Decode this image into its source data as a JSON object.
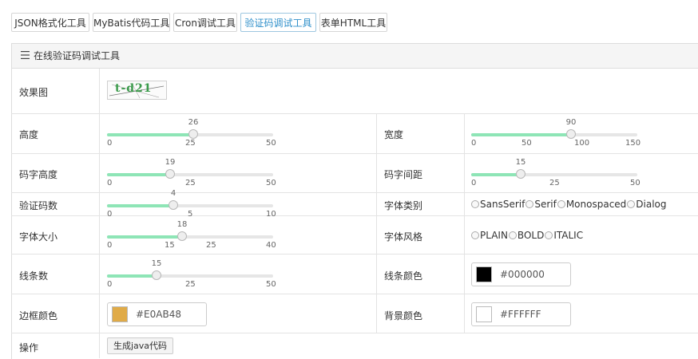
{
  "tabs": [
    {
      "label": "JSON格式化工具",
      "active": false
    },
    {
      "label": "MyBatis代码工具",
      "active": false
    },
    {
      "label": "Cron调试工具",
      "active": false
    },
    {
      "label": "验证码调试工具",
      "active": true
    },
    {
      "label": "表单HTML工具",
      "active": false
    }
  ],
  "panel": {
    "title": "在线验证码调试工具"
  },
  "rows": {
    "preview": {
      "label": "效果图",
      "captcha_text": "t-d21"
    },
    "height": {
      "label": "高度",
      "value": 26,
      "min": 0,
      "max": 50,
      "ticks": [
        "0",
        "25",
        "50"
      ]
    },
    "width": {
      "label": "宽度",
      "value": 90,
      "min": 0,
      "max": 150,
      "ticks": [
        "0",
        "50",
        "100",
        "150"
      ]
    },
    "font_height": {
      "label": "码字高度",
      "value": 19,
      "min": 0,
      "max": 50,
      "ticks": [
        "0",
        "25",
        "50"
      ]
    },
    "char_spacing": {
      "label": "码字间距",
      "value": 15,
      "min": 0,
      "max": 50,
      "ticks": [
        "0",
        "25",
        "50"
      ]
    },
    "char_count": {
      "label": "验证码数",
      "value": 4,
      "min": 0,
      "max": 10,
      "ticks": [
        "0",
        "5",
        "10"
      ]
    },
    "font_family": {
      "label": "字体类别",
      "options": [
        "SansSerif",
        "Serif",
        "Monospaced",
        "Dialog"
      ]
    },
    "font_size": {
      "label": "字体大小",
      "value": 18,
      "min": 0,
      "max": 40,
      "ticks": [
        "0",
        "15",
        "25",
        "40"
      ]
    },
    "font_style": {
      "label": "字体风格",
      "options": [
        "PLAIN",
        "BOLD",
        "ITALIC"
      ]
    },
    "noise_lines": {
      "label": "线条数",
      "value": 15,
      "min": 0,
      "max": 50,
      "ticks": [
        "0",
        "25",
        "50"
      ]
    },
    "line_color": {
      "label": "线条颜色",
      "value": "#000000",
      "swatch": "#000000"
    },
    "border_color": {
      "label": "边框颜色",
      "value": "#E0AB48",
      "swatch": "#E0AB48"
    },
    "bg_color": {
      "label": "背景颜色",
      "value": "#FFFFFF",
      "swatch": "#FFFFFF"
    },
    "action": {
      "label": "操作",
      "button": "生成java代码"
    }
  },
  "colors": {
    "accent": "#2e8fca",
    "slider_fill": "#8ee5b6"
  }
}
